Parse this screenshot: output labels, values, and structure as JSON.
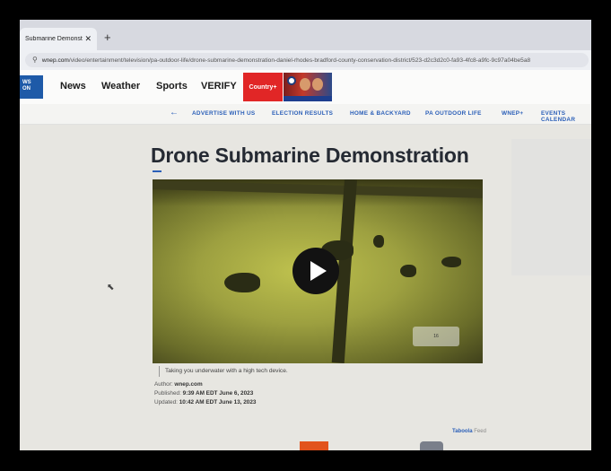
{
  "browser": {
    "tab_title": "Submarine Demonstratio",
    "tab_close": "✕",
    "new_tab": "+",
    "url_host": "wnep.com",
    "url_path": "/video/entertainment/television/pa-outdoor-life/drone-submarine-demonstration-daniel-rhodes-bradford-county-conservation-district/523-d2c3d2c0-fa93-4fc8-a9fc-9c97a04be5a8"
  },
  "site": {
    "logo_text": "WS\nON",
    "nav": [
      "News",
      "Weather",
      "Sports",
      "VERIFY"
    ],
    "promo_label": "Country+"
  },
  "subnav": {
    "back_icon": "arrow-left-icon",
    "items": [
      "ADVERTISE WITH US",
      "ELECTION RESULTS",
      "HOME & BACKYARD",
      "PA OUTDOOR LIFE",
      "WNEP+",
      "EVENTS CALENDAR"
    ]
  },
  "article": {
    "title": "Drone Submarine Demonstration",
    "video_watermark": "16",
    "caption": "Taking you underwater with a high tech device.",
    "author_label": "Author:",
    "author": "wnep.com",
    "published_label": "Published:",
    "published": "9:39 AM EDT June 6, 2023",
    "updated_label": "Updated:",
    "updated": "10:42 AM EDT June 13, 2023"
  },
  "footer": {
    "taboola_brand": "Taboola",
    "taboola_feed": "Feed"
  },
  "colors": {
    "accent": "#2b5fb8",
    "promo_red": "#e12626",
    "logo_blue": "#1e5aa8"
  }
}
